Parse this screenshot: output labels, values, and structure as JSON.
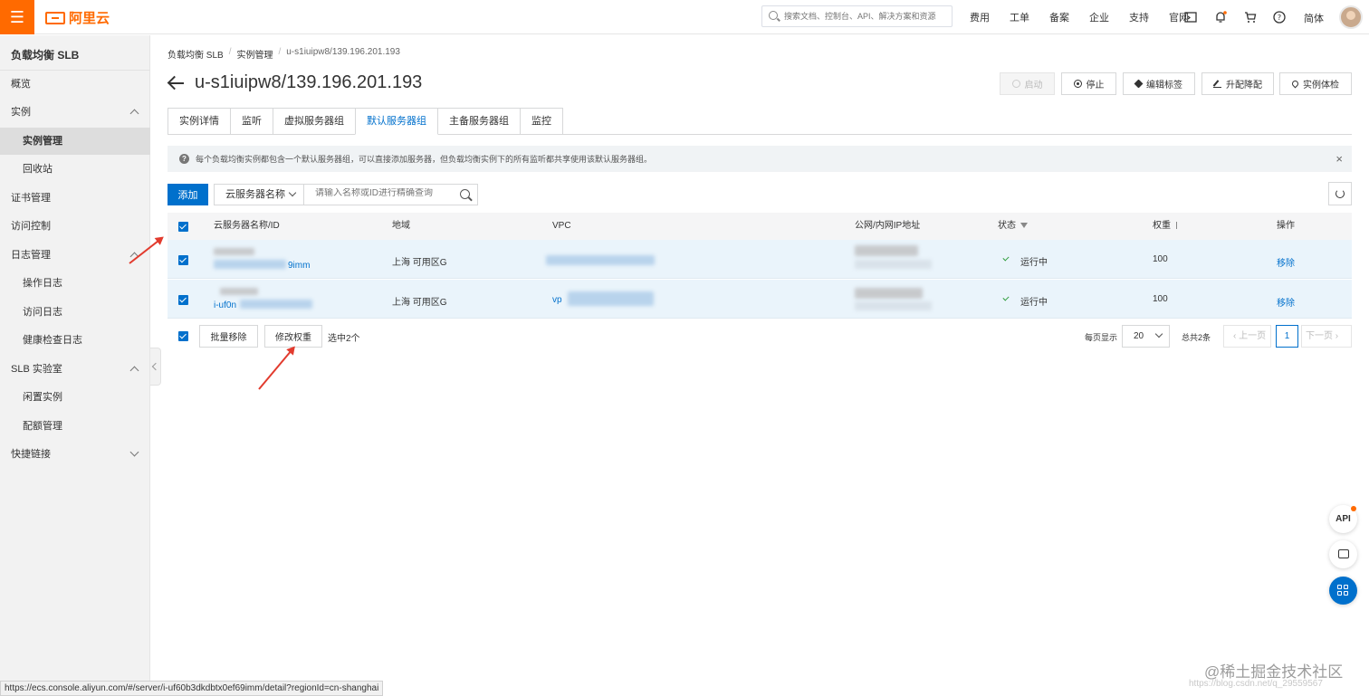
{
  "topbar": {
    "logo_text": "阿里云",
    "search_placeholder": "搜索文档、控制台、API、解决方案和资源",
    "links": [
      "费用",
      "工单",
      "备案",
      "企业",
      "支持",
      "官网"
    ],
    "language": "简体"
  },
  "sidebar": {
    "title": "负载均衡 SLB",
    "items": [
      {
        "label": "概览"
      },
      {
        "label": "实例"
      },
      {
        "label": "实例管理"
      },
      {
        "label": "回收站"
      },
      {
        "label": "证书管理"
      },
      {
        "label": "访问控制"
      },
      {
        "label": "日志管理"
      },
      {
        "label": "操作日志"
      },
      {
        "label": "访问日志"
      },
      {
        "label": "健康检查日志"
      },
      {
        "label": "SLB 实验室"
      },
      {
        "label": "闲置实例"
      },
      {
        "label": "配额管理"
      },
      {
        "label": "快捷链接"
      }
    ]
  },
  "breadcrumb": [
    "负载均衡 SLB",
    "实例管理",
    "u-s1iuipw8/139.196.201.193"
  ],
  "page_title": "u-s1iuipw8/139.196.201.193",
  "actions": {
    "start": "启动",
    "stop": "停止",
    "edit_tags": "编辑标签",
    "upgrade": "升配降配",
    "health": "实例体检"
  },
  "tabs": [
    "实例详情",
    "监听",
    "虚拟服务器组",
    "默认服务器组",
    "主备服务器组",
    "监控"
  ],
  "alert": {
    "text": "每个负载均衡实例都包含一个默认服务器组，可以直接添加服务器，但负载均衡实例下的所有监听都共享使用该默认服务器组。",
    "close": "×"
  },
  "toolbar": {
    "add": "添加",
    "filter": "云服务器名称",
    "search_placeholder": "请输入名称或ID进行精确查询"
  },
  "table": {
    "headers": [
      "云服务器名称/ID",
      "地域",
      "VPC",
      "公网/内网IP地址",
      "状态",
      "权重",
      "操作"
    ],
    "rows": [
      {
        "name_suffix": "9imm",
        "region": "上海 可用区G",
        "vpc_prefix": "",
        "status": "运行中",
        "weight": "100",
        "action": "移除"
      },
      {
        "name_suffix": "i-uf0n",
        "region": "上海 可用区G",
        "vpc_prefix": "vp",
        "status": "运行中",
        "weight": "100",
        "action": "移除"
      }
    ]
  },
  "footer": {
    "batch_remove": "批量移除",
    "modify_weight": "修改权重",
    "selected": "选中2个",
    "per_page_label": "每页显示",
    "per_page": "20",
    "total": "总共2条",
    "prev": "上一页",
    "page": "1",
    "next": "下一页"
  },
  "floating": {
    "api": "API"
  },
  "status_url": "https://ecs.console.aliyun.com/#/server/i-uf60b3dkdbtx0ef69imm/detail?regionId=cn-shanghai",
  "watermark": "@稀土掘金技术社区",
  "watermark_sub": "https://blog.csdn.net/q_29559567"
}
